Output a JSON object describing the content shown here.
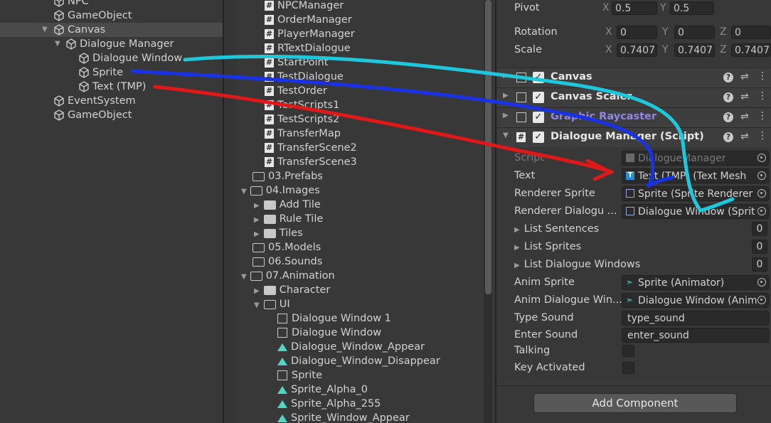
{
  "hierarchy": {
    "items": [
      {
        "label": "NPC",
        "indent": 0
      },
      {
        "label": "GameObject",
        "indent": 0
      },
      {
        "label": "Canvas",
        "indent": 0
      },
      {
        "label": "Dialogue Manager",
        "indent": 1
      },
      {
        "label": "Dialogue Window",
        "indent": 2
      },
      {
        "label": "Sprite",
        "indent": 2
      },
      {
        "label": "Text (TMP)",
        "indent": 2
      },
      {
        "label": "EventSystem",
        "indent": 0
      },
      {
        "label": "GameObject",
        "indent": 0
      }
    ]
  },
  "project": {
    "scripts": [
      "NPCManager",
      "OrderManager",
      "PlayerManager",
      "RTextDialogue",
      "StartPoint",
      "TestDialogue",
      "TestOrder",
      "TestScripts1",
      "TestScripts2",
      "TransferMap",
      "TransferScene2",
      "TransferScene3"
    ],
    "folders": [
      {
        "label": "03.Prefabs"
      },
      {
        "label": "04.Images"
      },
      {
        "label": "Add Tile"
      },
      {
        "label": "Rule Tile"
      },
      {
        "label": "Tiles"
      },
      {
        "label": "05.Models"
      },
      {
        "label": "06.Sounds"
      },
      {
        "label": "07.Animation"
      },
      {
        "label": "Character"
      },
      {
        "label": "UI"
      }
    ],
    "anim_items": [
      "Dialogue Window 1",
      "Dialogue Window",
      "Dialogue_Window_Appear",
      "Dialogue_Window_Disappear",
      "Sprite",
      "Sprite_Alpha_0",
      "Sprite_Alpha_255",
      "Sprite_Window_Appear"
    ]
  },
  "inspector": {
    "pivot": {
      "label": "Pivot",
      "x": "0.5",
      "y": "0.5"
    },
    "rotation": {
      "label": "Rotation",
      "x": "0",
      "y": "0",
      "z": "0"
    },
    "scale": {
      "label": "Scale",
      "x": "0.7407",
      "y": "0.7407",
      "z": "0.7407"
    },
    "axes": {
      "x": "X",
      "y": "Y",
      "z": "Z"
    },
    "components": [
      "Canvas",
      "Canvas Scaler",
      "Graphic Raycaster",
      "Dialogue Manager (Script)"
    ],
    "help_glyph": "?",
    "check_glyph": "✓",
    "fields": {
      "script": {
        "label": "Script",
        "value": "DialogueManager"
      },
      "text": {
        "label": "Text",
        "value": "Text (TMP) (Text Mesh"
      },
      "renderer_sprite": {
        "label": "Renderer Sprite",
        "value": "Sprite (Sprite Renderer"
      },
      "renderer_dialogue": {
        "label": "Renderer Dialogu ...",
        "value": "Dialogue Window (Sprit"
      },
      "list_sentences": {
        "label": "List Sentences",
        "value": "0"
      },
      "list_sprites": {
        "label": "List Sprites",
        "value": "0"
      },
      "list_dialogue_windows": {
        "label": "List Dialogue Windows",
        "value": "0"
      },
      "anim_sprite": {
        "label": "Anim Sprite",
        "value": "Sprite (Animator)"
      },
      "anim_dialogue": {
        "label": "Anim Dialogue Win...",
        "value": "Dialogue Window (Anim"
      },
      "type_sound": {
        "label": "Type Sound",
        "value": "type_sound"
      },
      "enter_sound": {
        "label": "Enter Sound",
        "value": "enter_sound"
      },
      "talking": {
        "label": "Talking"
      },
      "key_activated": {
        "label": "Key Activated"
      }
    },
    "add_component": "Add Component"
  },
  "colors": {
    "arrow_cyan": "#1ec8dc",
    "arrow_blue": "#1a32e6",
    "arrow_red": "#e01818",
    "anim_icon": "#4fd6c6",
    "raycaster_title": "#8f86e8"
  }
}
